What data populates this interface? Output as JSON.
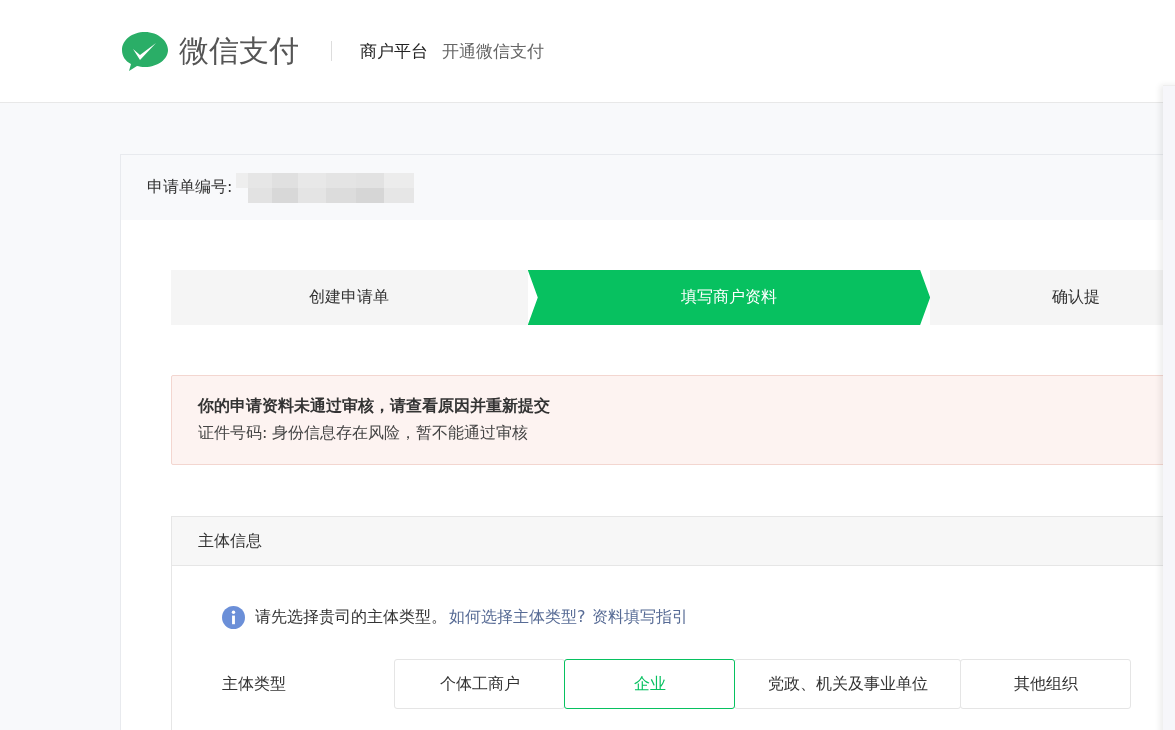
{
  "header": {
    "brand": "微信支付",
    "nav": [
      "商户平台",
      "开通微信支付"
    ]
  },
  "application": {
    "label": "申请单编号:"
  },
  "steps": [
    {
      "label": "创建申请单",
      "selected": false
    },
    {
      "label": "填写商户资料",
      "selected": true
    },
    {
      "label": "确认提",
      "selected": false
    }
  ],
  "alert": {
    "title": "你的申请资料未通过审核，请查看原因并重新提交",
    "detail": "证件号码: 身份信息存在风险，暂不能通过审核"
  },
  "section": {
    "title": "主体信息",
    "hint": "请先选择贵司的主体类型。",
    "links": [
      "如何选择主体类型?",
      "资料填写指引"
    ],
    "field_label": "主体类型",
    "options": [
      {
        "label": "个体工商户",
        "selected": false
      },
      {
        "label": "企业",
        "selected": true
      },
      {
        "label": "党政、机关及事业单位",
        "selected": false
      },
      {
        "label": "其他组织",
        "selected": false
      }
    ]
  }
}
